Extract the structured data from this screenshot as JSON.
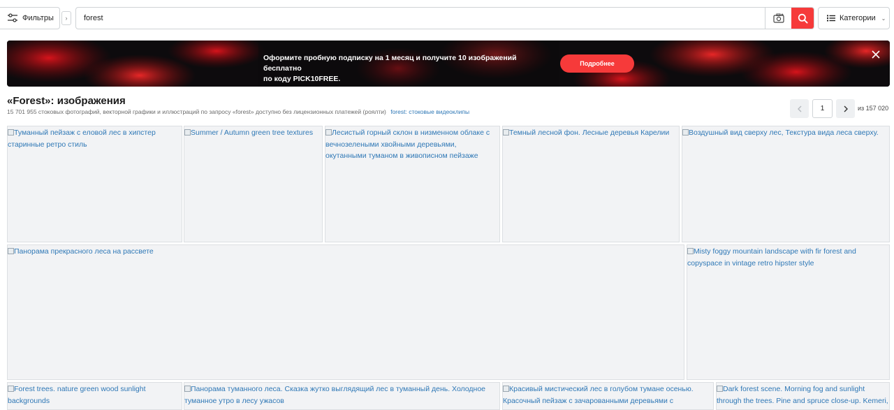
{
  "header": {
    "filters_label": "Фильтры",
    "filters_arrow": "›",
    "search_value": "forest",
    "categories_label": "Категории",
    "categories_chevron": "⌄",
    "accent_color": "#f63a3a"
  },
  "banner": {
    "text_line1": "Оформите пробную подписку на 1 месяц и получите 10 изображений бесплатно",
    "text_line2": "по коду PICK10FREE.",
    "button_label": "Подробнее"
  },
  "results": {
    "title": "«Forest»: изображения",
    "subtitle": "15 701 955 стоковых фотографий, векторной графики и иллюстраций по запросу «forest» доступно без лицензионных платежей (роялти)",
    "video_link": "forest: стоковые видеоклипы"
  },
  "pagination": {
    "current_page": "1",
    "total": "из 157 020"
  },
  "images": [
    {
      "alt": "Туманный пейзаж с еловой лес в хипстер старинные ретро стиль"
    },
    {
      "alt": "Summer / Autumn green tree textures"
    },
    {
      "alt": "Лесистый горный склон в низменном облаке с вечнозелеными хвойными деревьями, окутанными туманом в живописном пейзаже"
    },
    {
      "alt": "Темный лесной фон. Лесные деревья Карелии"
    },
    {
      "alt": "Воздушный вид сверху лес, Текстура вида леса сверху."
    },
    {
      "alt": "Панорама прекрасного леса на рассвете"
    },
    {
      "alt": "Misty foggy mountain landscape with fir forest and copyspace in vintage retro hipster style"
    },
    {
      "alt": "Forest trees. nature green wood sunlight backgrounds"
    },
    {
      "alt": "Панорама туманного леса. Сказка жутко выглядящий лес в туманный день. Холодное туманное утро в лесу ужасов"
    },
    {
      "alt": "Красивый мистический лес в голубом тумане осенью. Красочный пейзаж с зачарованными деревьями с"
    },
    {
      "alt": "Dark forest scene. Morning fog and sunlight through the trees. Pine and spruce close-up. Kemeri,"
    }
  ]
}
